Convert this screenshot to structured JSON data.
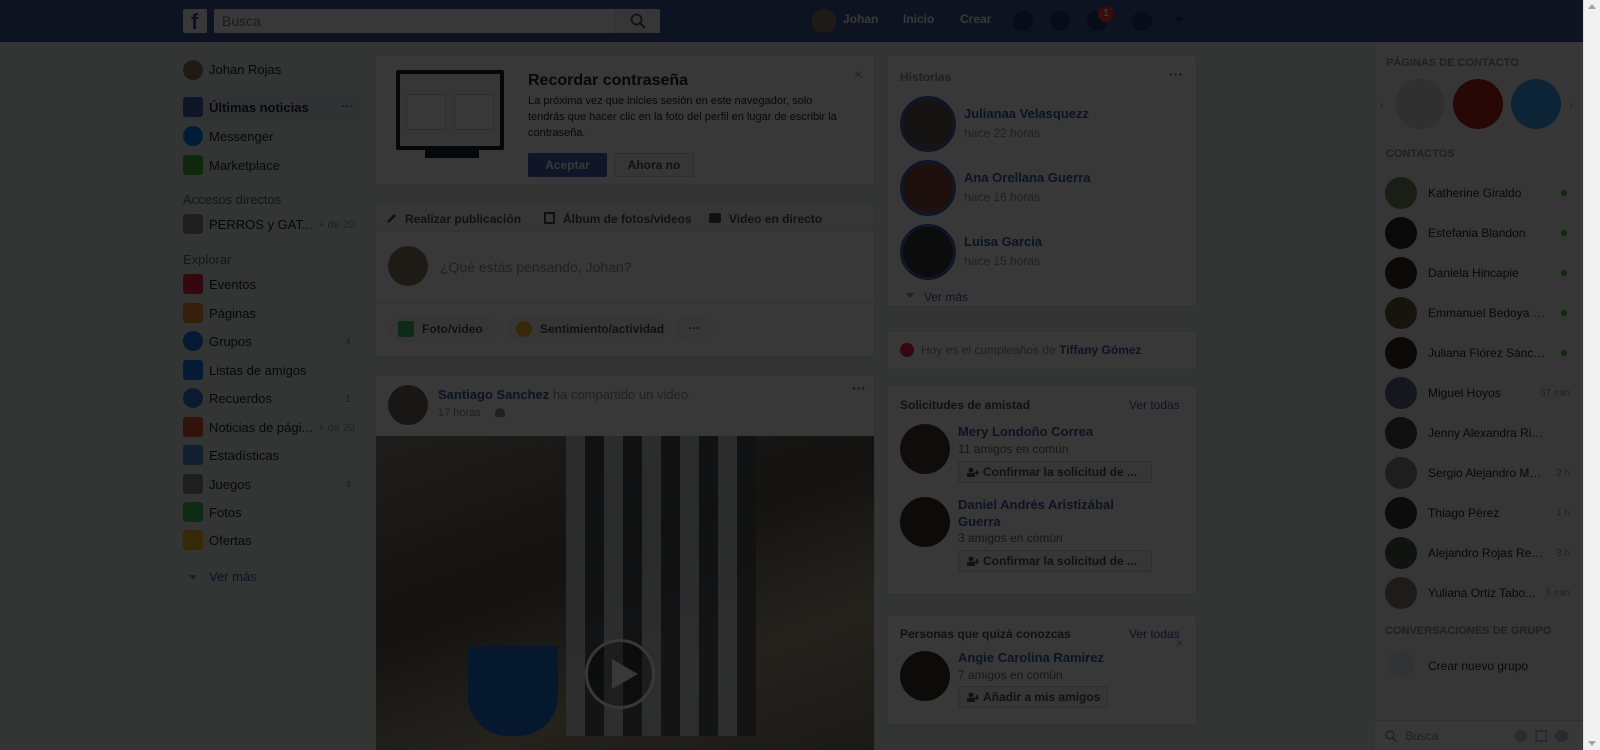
{
  "topbar": {
    "logo": "f",
    "search_placeholder": "Busca",
    "user_name": "Johan",
    "nav_home": "Inicio",
    "nav_create": "Crear",
    "notification_count": "1"
  },
  "left_nav": {
    "profile": "Johan Rojas",
    "news_feed": "Últimas noticias",
    "messenger": "Messenger",
    "marketplace": "Marketplace",
    "shortcuts_heading": "Accesos directos",
    "shortcut_item": "PERROS y GAT...",
    "shortcut_count": "+ de 20",
    "explore_heading": "Explorar",
    "explore_items": [
      {
        "label": "Eventos",
        "count": ""
      },
      {
        "label": "Páginas",
        "count": ""
      },
      {
        "label": "Grupos",
        "count": "4"
      },
      {
        "label": "Listas de amigos",
        "count": ""
      },
      {
        "label": "Recuerdos",
        "count": "1"
      },
      {
        "label": "Noticias de pági...",
        "count": "+ de 20"
      },
      {
        "label": "Estadísticas",
        "count": ""
      },
      {
        "label": "Juegos",
        "count": "4"
      },
      {
        "label": "Fotos",
        "count": ""
      },
      {
        "label": "Ofertas",
        "count": ""
      }
    ],
    "see_more": "Ver más"
  },
  "password_card": {
    "title": "Recordar contraseña",
    "body": "La próxima vez que inicies sesión en este navegador, solo tendrás que hacer clic en la foto del perfil en lugar de escribir la contraseña.",
    "accept": "Aceptar",
    "not_now": "Ahora no"
  },
  "composer": {
    "tab_post": "Realizar publicación",
    "tab_album": "Álbum de fotos/videos",
    "tab_live": "Video en directo",
    "placeholder": "¿Qué estás pensando, Johan?",
    "photo_video": "Foto/video",
    "feeling": "Sentimiento/actividad"
  },
  "post": {
    "author": "Santiago Sanchez",
    "action": "ha compartido un video.",
    "time": "17 horas"
  },
  "stories": {
    "heading": "Historias",
    "items": [
      {
        "name": "Julianaa Velasquezz",
        "time": "hace 22 horas"
      },
      {
        "name": "Ana Orellana Guerra",
        "time": "hace 16 horas"
      },
      {
        "name": "Luisa Garcia",
        "time": "hace 15 horas"
      }
    ],
    "see_more": "Ver más"
  },
  "birthday": {
    "prefix": "Hoy es el cumpleaños de",
    "name": "Tiffany Gómez"
  },
  "friend_requests": {
    "heading": "Solicitudes de amistad",
    "see_all": "Ver todas",
    "items": [
      {
        "name": "Mery Londoño Correa",
        "mutual": "11 amigos en común",
        "button": "Confirmar la solicitud de ..."
      },
      {
        "name": "Daniel Andrés Aristizábal Guerra",
        "mutual": "3 amigos en común",
        "button": "Confirmar la solicitud de ..."
      }
    ]
  },
  "people_you_may_know": {
    "heading": "Personas que quizá conozcas",
    "see_all": "Ver todas",
    "name": "Angie Carolina Ramirez",
    "mutual": "7 amigos en común",
    "button": "Añadir a mis amigos"
  },
  "right_rail": {
    "pages_heading": "PÁGINAS DE CONTACTO",
    "contacts_heading": "CONTACTOS",
    "contacts": [
      {
        "name": "Katherine Giraldo",
        "status": "online"
      },
      {
        "name": "Estefania Blandon",
        "status": "online"
      },
      {
        "name": "Daniela Hincapie",
        "status": "online"
      },
      {
        "name": "Emmanuel Bedoya U...",
        "status": "online"
      },
      {
        "name": "Juliana Flórez Sánchez",
        "status": "online"
      },
      {
        "name": "Miguel Hoyos",
        "status": "57 min"
      },
      {
        "name": "Jenny Alexandra Rios Go...",
        "status": ""
      },
      {
        "name": "Sergio Alejandro Ma...",
        "status": "2 h"
      },
      {
        "name": "Thiago Pérez",
        "status": "1 h"
      },
      {
        "name": "Alejandro Rojas Red...",
        "status": "3 h"
      },
      {
        "name": "Yuliana Ortiz Tabo...",
        "status": "5 min"
      }
    ],
    "group_conversations": "CONVERSACIONES DE GRUPO",
    "create_group": "Crear nuevo grupo",
    "chat_search": "Busca"
  }
}
